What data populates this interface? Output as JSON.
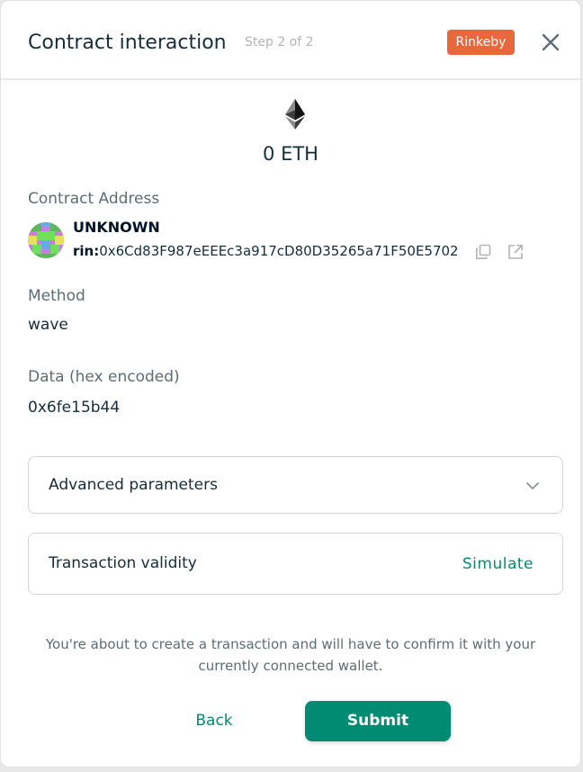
{
  "header": {
    "title": "Contract interaction",
    "step": "Step 2 of 2",
    "network": "Rinkeby",
    "network_color": "#e8673c"
  },
  "amount": {
    "value": "0 ETH",
    "icon": "ethereum-icon"
  },
  "contract": {
    "label": "Contract Address",
    "name": "UNKNOWN",
    "prefix": "rin:",
    "address": "0x6Cd83F987eEEEc3a917cD80D35265a71F50E5702",
    "copy_icon": "copy-icon",
    "explorer_icon": "external-link-icon"
  },
  "method": {
    "label": "Method",
    "value": "wave"
  },
  "data": {
    "label": "Data (hex encoded)",
    "value": "0x6fe15b44"
  },
  "advanced": {
    "label": "Advanced parameters",
    "icon": "chevron-down-icon"
  },
  "validity": {
    "label": "Transaction validity",
    "action": "Simulate"
  },
  "notice": {
    "line1": "You're about to create a transaction and will have to confirm it with your",
    "line2": "currently connected wallet."
  },
  "buttons": {
    "back": "Back",
    "submit": "Submit"
  },
  "colors": {
    "primary": "#008c73",
    "text": "#162d3a",
    "muted": "#5d6d74"
  }
}
